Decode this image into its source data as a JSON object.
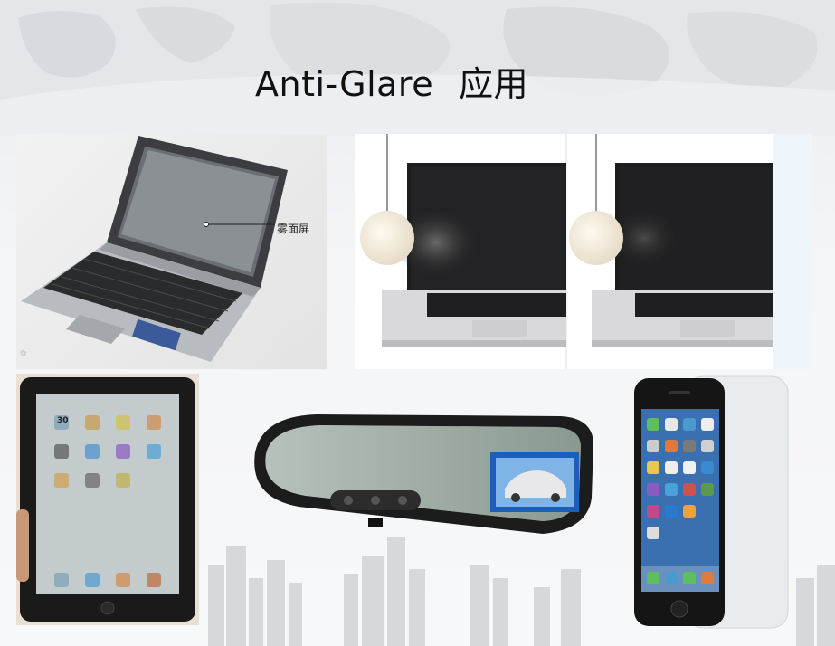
{
  "slide": {
    "title_en": "Anti-Glare",
    "title_cn": "应用",
    "laptop_callout": "雾面屏",
    "ipad_date_icon": "30"
  },
  "colors": {
    "title": "#111111",
    "background": "#f4f5f7",
    "map_shade": "#d7dade",
    "skyline": "#d2d5d9"
  }
}
